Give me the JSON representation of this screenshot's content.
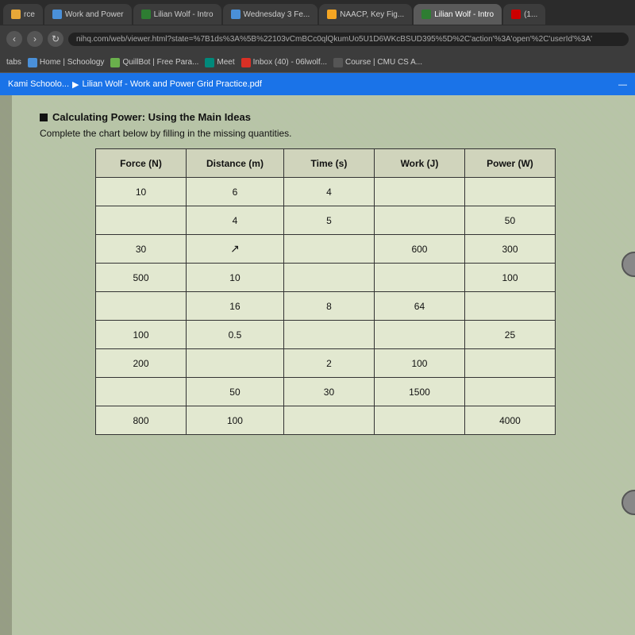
{
  "browser": {
    "tabs": [
      {
        "label": "rce",
        "icon_color": "#e8a838",
        "active": false
      },
      {
        "label": "Work and Power",
        "icon_color": "#4a90d9",
        "active": false
      },
      {
        "label": "Lilian Wolf - Intro",
        "icon_color": "#2e7d32",
        "active": false
      },
      {
        "label": "Wednesday 3 Fe...",
        "icon_color": "#4a90d9",
        "active": false
      },
      {
        "label": "NAACP, Key Fig...",
        "icon_color": "#f5a623",
        "active": false
      },
      {
        "label": "Lilian Wolf - Intro",
        "icon_color": "#2e7d32",
        "active": true
      },
      {
        "label": "(1...",
        "icon_color": "#cc0000",
        "active": false
      }
    ],
    "address_bar": "nihq.com/web/viewer.html?state=%7B1ds%3A%5B%22103vCmBCc0qlQkumUo5U1D6WKcBSUD395%5D%2C'action'%3A'open'%2C'userId'%3A'",
    "bookmarks": [
      {
        "label": "tabs"
      },
      {
        "label": "Home | Schoology",
        "icon_color": "#4a90d9"
      },
      {
        "label": "QuillBot | Free Para...",
        "icon_color": "#6ab04c"
      },
      {
        "label": "Meet",
        "icon_color": "#00897b"
      },
      {
        "label": "Inbox (40) - 06lwolf...",
        "icon_color": "#d93025"
      },
      {
        "label": "Course | CMU CS A...",
        "icon_color": "#555"
      }
    ],
    "kami_toolbar": {
      "app_name": "Kami Schoolo...",
      "separator": "▶",
      "document_name": "Lilian Wolf - Work and Power Grid Practice.pdf",
      "minimize_label": "—"
    }
  },
  "document": {
    "section_title": "Calculating Power: Using the Main Ideas",
    "instructions": "Complete the chart below by filling in the missing quantities.",
    "table": {
      "headers": [
        "Force (N)",
        "Distance (m)",
        "Time (s)",
        "Work (J)",
        "Power (W)"
      ],
      "rows": [
        {
          "force": "10",
          "distance": "6",
          "time": "4",
          "work": "",
          "power": ""
        },
        {
          "force": "",
          "distance": "4",
          "time": "5",
          "work": "",
          "power": "50"
        },
        {
          "force": "30",
          "distance": "",
          "time": "",
          "work": "600",
          "power": "300"
        },
        {
          "force": "500",
          "distance": "10",
          "time": "",
          "work": "",
          "power": "100"
        },
        {
          "force": "",
          "distance": "16",
          "time": "8",
          "work": "64",
          "power": ""
        },
        {
          "force": "100",
          "distance": "0.5",
          "time": "",
          "work": "",
          "power": "25"
        },
        {
          "force": "200",
          "distance": "",
          "time": "2",
          "work": "100",
          "power": ""
        },
        {
          "force": "",
          "distance": "50",
          "time": "30",
          "work": "1500",
          "power": ""
        },
        {
          "force": "800",
          "distance": "100",
          "time": "",
          "work": "",
          "power": "4000"
        }
      ]
    }
  }
}
